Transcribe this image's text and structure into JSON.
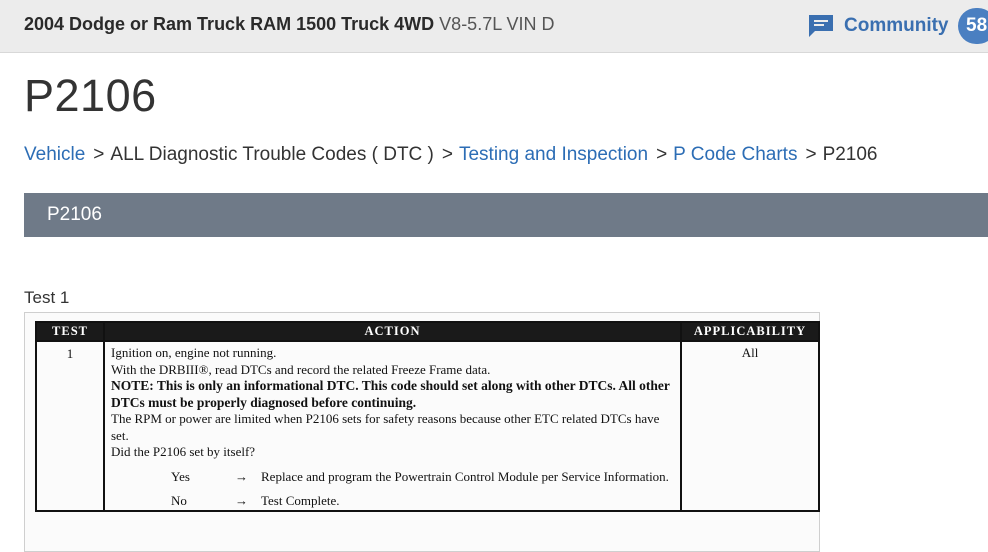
{
  "header": {
    "vehicle_bold": "2004 Dodge or Ram Truck RAM 1500 Truck 4WD",
    "engine": "V8-5.7L VIN D",
    "community_label": "Community",
    "community_count": "58"
  },
  "page": {
    "title": "P2106"
  },
  "breadcrumb": {
    "items": [
      {
        "label": "Vehicle",
        "link": true
      },
      {
        "label": "ALL Diagnostic Trouble Codes ( DTC )",
        "link": false
      },
      {
        "label": "Testing and Inspection",
        "link": true
      },
      {
        "label": "P Code Charts",
        "link": true
      },
      {
        "label": "P2106",
        "link": false
      }
    ],
    "separator": ">"
  },
  "section": {
    "title": "P2106"
  },
  "test": {
    "label": "Test 1",
    "headers": {
      "test": "TEST",
      "action": "ACTION",
      "applicability": "APPLICABILITY"
    },
    "number": "1",
    "lines": [
      "Ignition on, engine not running.",
      "With the DRBIII®, read DTCs and record the related Freeze Frame data."
    ],
    "note": "NOTE: This is only an informational DTC. This code should set along with other DTCs. All other DTCs must be properly diagnosed before continuing.",
    "info": "The RPM or power are limited when P2106 sets for safety reasons because other ETC related DTCs have set.",
    "question": "Did the P2106 set by itself?",
    "yes_label": "Yes",
    "yes_result": "Replace and program the Powertrain Control Module per Service Information.",
    "no_label": "No",
    "no_result": "Test Complete.",
    "arrow": "→",
    "applicability": "All"
  },
  "colors": {
    "link": "#2c6db5",
    "section_bar": "#6f7a88",
    "topbar": "#ececec",
    "badge": "#4a7fc1"
  },
  "icons": {
    "community": "chat-bubble-icon"
  }
}
